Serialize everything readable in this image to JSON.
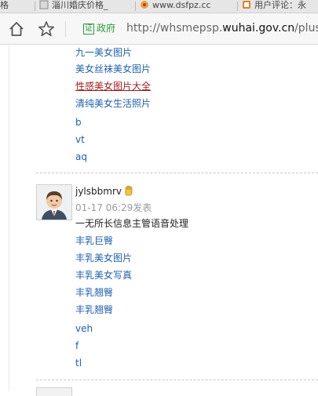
{
  "tabs": [
    {
      "label": "格",
      "icon": "tab-page-icon"
    },
    {
      "label": "淄川婚庆价格_",
      "icon": "tab-page-icon"
    },
    {
      "label": "www.dsfpz.cc",
      "icon": "tab-favicon-icon"
    },
    {
      "label": "用户评论：永",
      "icon": "tab-favicon-icon"
    }
  ],
  "addressbar": {
    "cert_badge": "证",
    "cert_label": "政府",
    "url_prefix": "http://whsmepsp.",
    "url_domain": "wuhai.gov.cn",
    "url_suffix": "/plus/"
  },
  "top_links": [
    "九一美女图片",
    "美女丝袜美女图片",
    "性感美女图片大全",
    "清纯美女生活照片",
    "b",
    "vt",
    "aq"
  ],
  "post": {
    "username": "jylsbbmrv",
    "time": "01-17 06:29发表",
    "text": "一无所长信息主管语音处理",
    "links": [
      "丰乳巨臀",
      "丰乳美女图片",
      "丰乳美女写真",
      "丰乳翘臀",
      "丰乳翘臀",
      "veh",
      "f",
      "tl"
    ]
  }
}
